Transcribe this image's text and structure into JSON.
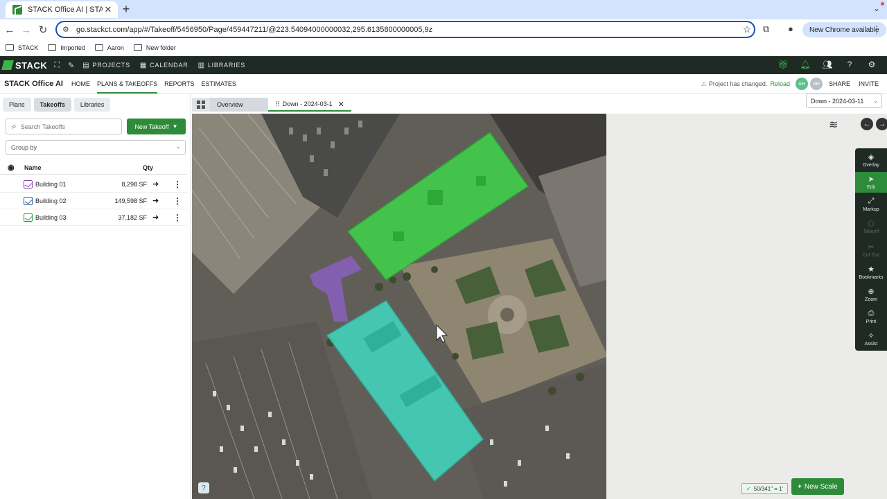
{
  "browser": {
    "tab_title": "STACK Office AI | STACK",
    "url": "go.stackct.com/app/#/Takeoff/5456950/Page/459447211/@223.54094000000032,295.6135800000005,9z",
    "new_chrome": "New Chrome available",
    "bookmarks": [
      "STACK",
      "Imported",
      "Aaron",
      "New folder"
    ]
  },
  "appnav": {
    "logo": "STACK",
    "items": [
      "PROJECTS",
      "CALENDAR",
      "LIBRARIES"
    ]
  },
  "subnav": {
    "company": "STACK Office AI",
    "items": [
      "HOME",
      "PLANS & TAKEOFFS",
      "REPORTS",
      "ESTIMATES"
    ],
    "notice": "Project has changed.",
    "reload": "Reload",
    "avatars": [
      "AH",
      "AH"
    ],
    "share": "SHARE",
    "invite": "INVITE"
  },
  "panel": {
    "tabs": [
      "Plans",
      "Takeoffs",
      "Libraries"
    ],
    "search_placeholder": "Search Takeoffs",
    "new_takeoff": "New Takeoff",
    "group_by": "Group by",
    "col_name": "Name",
    "col_qty": "Qty",
    "rows": [
      {
        "name": "Building 01",
        "qty": "8,298 SF",
        "color": "#8a3fb0"
      },
      {
        "name": "Building 02",
        "qty": "149,598 SF",
        "color": "#1f5aa8"
      },
      {
        "name": "Building 03",
        "qty": "37,182 SF",
        "color": "#2e9b3a"
      }
    ]
  },
  "viewer": {
    "tab_overview": "Overview",
    "tab_page": "Down - 2024-03-1",
    "page_select": "Down - 2024-03-11",
    "scale": "50/341\" = 1'",
    "new_scale": "New Scale",
    "tools": [
      "Overlay",
      "Edit",
      "Markup",
      "Takeoff",
      "Cut Out",
      "Bookmarks",
      "Zoom",
      "Print",
      "Assist"
    ]
  },
  "colors": {
    "accent": "#2e8b3a",
    "nav_bg": "#1f2a24",
    "takeoff_green": "#3fd14a",
    "takeoff_cyan": "#3ee0c8",
    "takeoff_purple": "#8a5fc0"
  }
}
